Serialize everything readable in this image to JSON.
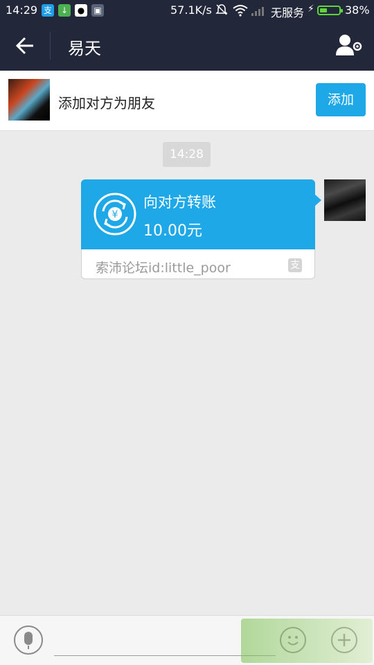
{
  "status_bar": {
    "time": "14:29",
    "speed": "57.1K/s",
    "carrier": "无服务",
    "battery_percent": "38%",
    "battery_level": 0.38,
    "app_icons": [
      "alipay-icon",
      "download-icon",
      "qq-icon",
      "gallery-icon"
    ]
  },
  "header": {
    "title": "易天"
  },
  "add_friend": {
    "prompt": "添加对方为朋友",
    "button_label": "添加"
  },
  "chat": {
    "timestamp": "14:28",
    "transfer": {
      "title": "向对方转账",
      "amount": "10.00元",
      "footer": "索沛论坛id:little_poor"
    }
  },
  "input": {
    "placeholder": ""
  },
  "colors": {
    "accent": "#1ea8e8",
    "header_bg": "#22283a",
    "chat_bg": "#ebebeb",
    "battery": "#5fd43c"
  }
}
